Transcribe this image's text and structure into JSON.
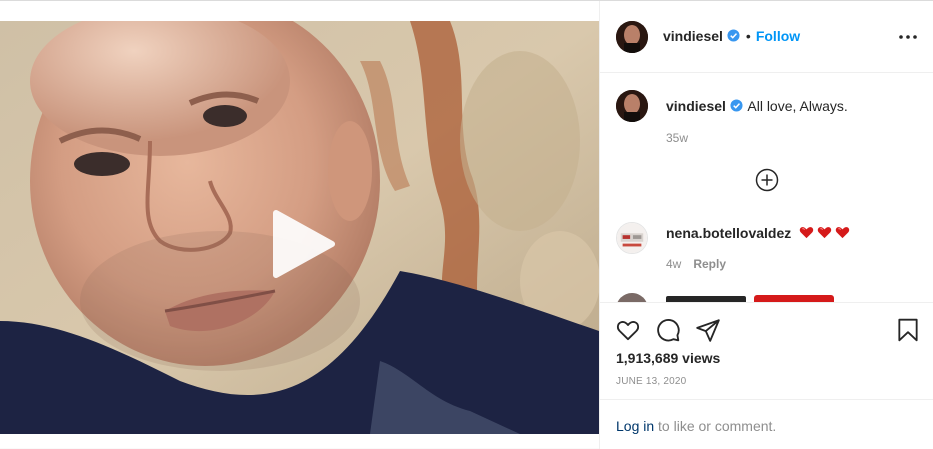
{
  "post": {
    "username": "vindiesel",
    "follow_label": "Follow",
    "separator": "•",
    "caption": {
      "username": "vindiesel",
      "text": "All love, Always.",
      "age": "35w"
    },
    "comments": [
      {
        "username": "nena.botellovaldez",
        "hearts": 3,
        "age": "4w",
        "reply_label": "Reply"
      }
    ],
    "views_text": "1,913,689 views",
    "date_text": "JUNE 13, 2020",
    "login": {
      "link_text": "Log in",
      "rest_text": "to like or comment."
    }
  },
  "colors": {
    "accent": "#0095f6",
    "verified": "#3897f0",
    "heart": "#d51a1a",
    "muted": "#8e8e8e"
  },
  "icons": [
    "play-icon",
    "verified-icon",
    "more-options-icon",
    "load-more-comments-icon",
    "like-icon",
    "comment-icon",
    "share-icon",
    "bookmark-icon"
  ]
}
